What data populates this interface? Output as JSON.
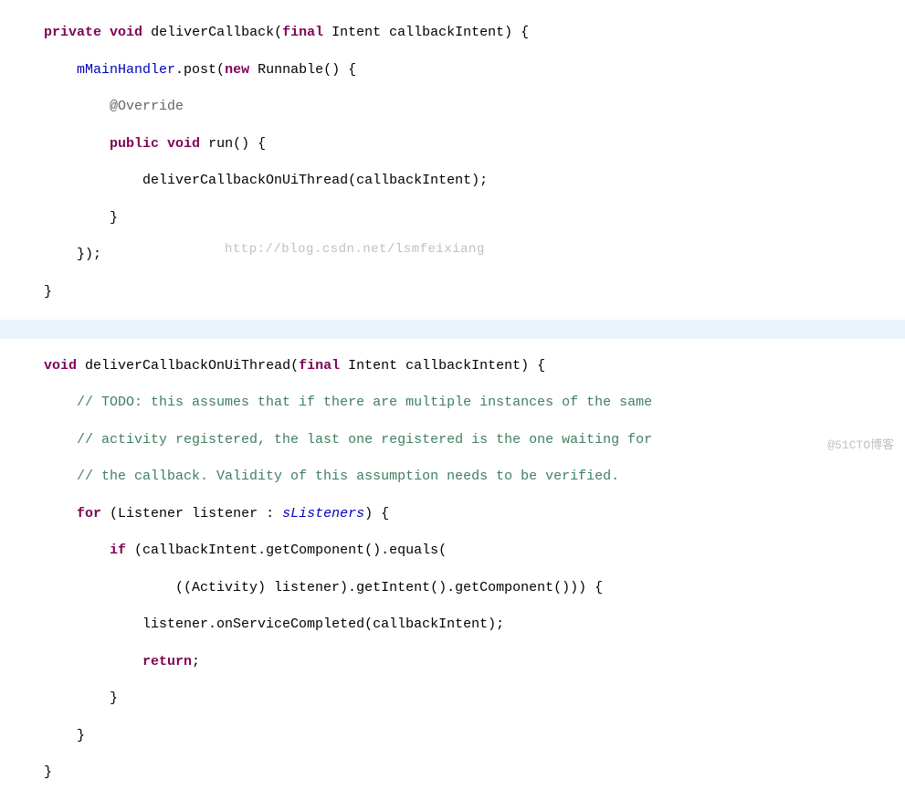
{
  "lines": {
    "l1_a": "private",
    "l1_b": "void",
    "l1_c": "deliverCallback(",
    "l1_d": "final",
    "l1_e": "Intent",
    "l1_f": "callbackIntent) {",
    "l2_a": "mMainHandler",
    "l2_b": ".post(",
    "l2_c": "new",
    "l2_d": "Runnable",
    "l2_e": "() {",
    "l3_a": "@Override",
    "l4_a": "public",
    "l4_b": "void",
    "l4_c": "run() {",
    "l5_a": "deliverCallbackOnUiThread(callbackIntent);",
    "l6_a": "}",
    "l7_a": "});",
    "l8_a": "}",
    "l10_a": "void",
    "l10_b": "deliverCallbackOnUiThread(",
    "l10_c": "final",
    "l10_d": "Intent",
    "l10_e": "callbackIntent) {",
    "l11_a": "// TODO: this assumes that if there are multiple instances of the same",
    "l12_a": "// activity registered, the last one registered is the one waiting for",
    "l13_a": "// the callback. Validity of this assumption needs to be verified.",
    "l14_a": "for",
    "l14_b": "(Listener listener : ",
    "l14_c": "sListeners",
    "l14_d": ") {",
    "l15_a": "if",
    "l15_b": "(callbackIntent.getComponent().equals(",
    "l16_a": "((Activity) listener).getIntent().getComponent())) {",
    "l17_a": "listener.onServiceCompleted(callbackIntent);",
    "l18_a": "return",
    "l18_b": ";",
    "l19_a": "}",
    "l20_a": "}",
    "l21_a": "}"
  },
  "watermark_url": "http://blog.csdn.net/lsmfeixiang",
  "watermark_bottom": "@51CTO博客"
}
